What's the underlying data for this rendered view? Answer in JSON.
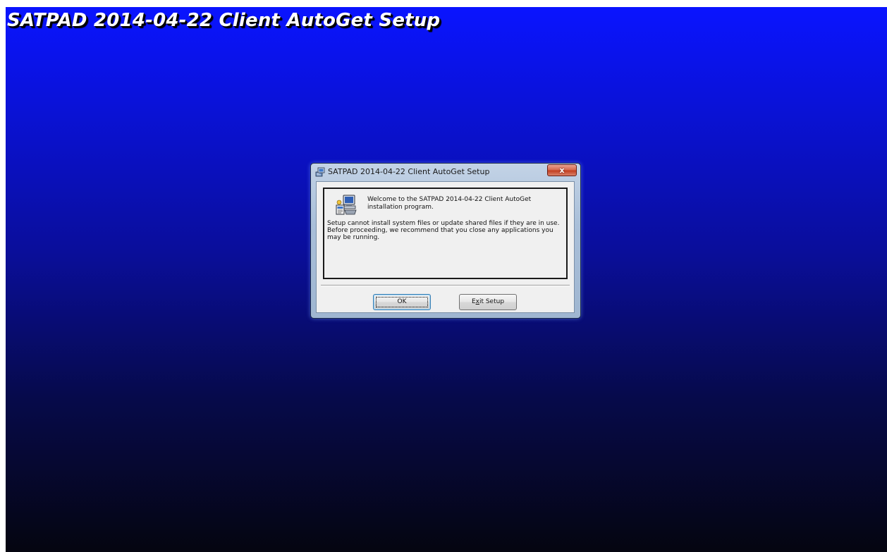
{
  "background": {
    "title": "SATPAD 2014-04-22 Client AutoGet Setup",
    "gradient_top": "#0a14ff",
    "gradient_bottom": "#050510"
  },
  "dialog": {
    "title": "SATPAD 2014-04-22 Client AutoGet Setup",
    "title_icon": "setup-app-icon",
    "close_icon": "close-icon",
    "close_glyph": "x",
    "close_color": "#c23f22",
    "welcome_text": "Welcome to the SATPAD 2014-04-22 Client AutoGet installation program.",
    "message_icon": "setup-computer-icon",
    "warning_text": "Setup cannot install system files or update shared files if they are in use. Before proceeding, we recommend that you close any applications you may be running.",
    "buttons": {
      "ok_label": "OK",
      "exit_label": "Exit Setup",
      "exit_label_pre": "E",
      "exit_label_accel": "x",
      "exit_label_post": "it Setup"
    }
  }
}
